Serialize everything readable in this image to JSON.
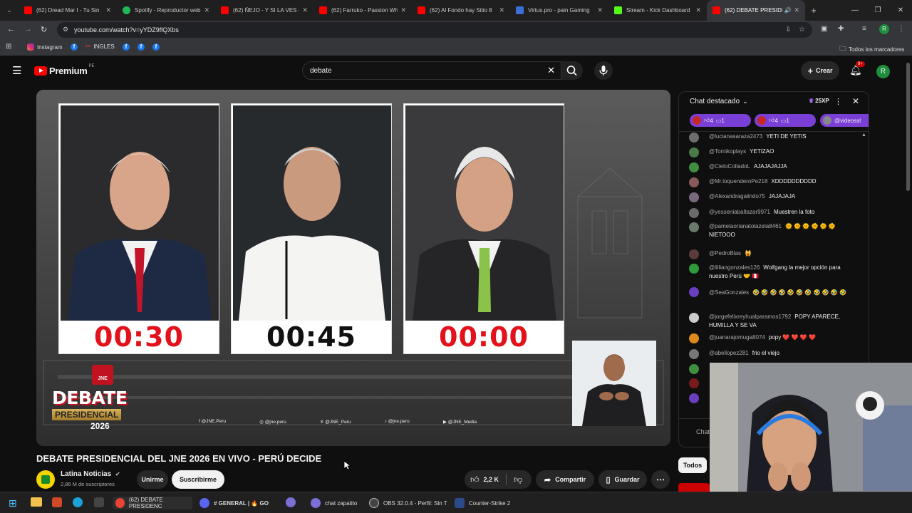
{
  "browser": {
    "tabs": [
      {
        "title": "(62) Dread Mar I - Tu Sin",
        "color": "#ff0000"
      },
      {
        "title": "Spotify - Reproductor web",
        "color": "#1db954"
      },
      {
        "title": "(62) ÑEJO - Y SI LA VES -",
        "color": "#ff0000"
      },
      {
        "title": "(62) Farruko - Passion Wh",
        "color": "#ff0000"
      },
      {
        "title": "(62) Al Fondo hay Sitio 8",
        "color": "#ff0000"
      },
      {
        "title": "Virtus.pro - pain Gaming",
        "color": "#3b6fd8"
      },
      {
        "title": "Stream - Kick Dashboard",
        "color": "#53fc18"
      },
      {
        "title": "(62) DEBATE PRESIDE",
        "color": "#ff0000"
      }
    ],
    "url": "youtube.com/watch?v=yYDZ9flQXbs",
    "bookmarks": {
      "instagram": "Instagram",
      "ingles": "INGLES",
      "all_bookmarks": "Todos los marcadores"
    }
  },
  "youtube": {
    "logo_text": "Premium",
    "region": "PE",
    "search_value": "debate",
    "create_label": "Crear",
    "notif_count": "9+",
    "avatar_letter": "R"
  },
  "video": {
    "timers": [
      "00:30",
      "00:45",
      "00:00"
    ],
    "brand_top": "JNE",
    "brand_title": "DEBATE",
    "brand_sub": "PRESIDENCIAL",
    "brand_year": "2026",
    "socials": [
      "@JNE.Peru",
      "@jne.peru",
      "@JNE_Peru",
      "@jne.peru",
      "@JNE_Media"
    ]
  },
  "meta": {
    "title": "DEBATE PRESIDENCIAL DEL JNE 2026 EN VIVO - PERÚ DECIDE",
    "channel": "Latina Noticias",
    "subscribers": "2,86 M de suscriptores",
    "join": "Unirme",
    "subscribe": "Suscribirme",
    "likes": "2,2 K",
    "share": "Compartir",
    "save": "Guardar"
  },
  "chat": {
    "header": "Chat destacado",
    "xp": "25XP",
    "chips": [
      "4",
      "1",
      "4",
      "1",
      "@videossl"
    ],
    "messages": [
      {
        "author": "@lucianasaraza2473",
        "text": "YETI DE YETIS",
        "color": "#6d6d6d"
      },
      {
        "author": "@Tomikoplays",
        "text": "YETIZAO",
        "color": "#4a7a4a"
      },
      {
        "author": "@CieloColladoL",
        "text": "AJAJAJAJJA",
        "color": "#3f8f3f"
      },
      {
        "author": "@Mr.loquenderoPe218",
        "text": "XDDDDDDDDDD",
        "color": "#8a5a5a"
      },
      {
        "author": "@Alexandragalindo75",
        "text": "JAJAJAJA",
        "color": "#7a6a80"
      },
      {
        "author": "@yesseniabaltazar9971",
        "text": "Muestren la foto",
        "color": "#6a6a6a"
      },
      {
        "author": "@pamelaorianatolazela8461",
        "text": "🌞 🌞 🌞 🌞 🌞 🌞 NIETOOO",
        "color": "#6a7a6a"
      },
      {
        "author": "@PedroBlas",
        "text": "🙀",
        "color": "#5a3a3a"
      },
      {
        "author": "@lilliangonzales126",
        "text": "Wolfgang la mejor opción para nuestro Perú 🤝 🇵🇪",
        "color": "#2e9a3a"
      },
      {
        "author": "@SeaGonzales",
        "text": "🤣 🤣 🤣 🤣 🤣 🤣 🤣 🤣 🤣 🤣 🤣",
        "color": "#6a3fbf"
      },
      {
        "author": "@jorgefelixreyhualparamos1792",
        "text": "POPY APARECE, HUMILLA Y SE VA",
        "color": "#cccccc"
      },
      {
        "author": "@juanarajomuga8074",
        "text": "popy ❤️ ❤️ ❤️ ❤️",
        "color": "#e08a1e"
      },
      {
        "author": "@abellopez281",
        "text": "frio el viejo",
        "color": "#777777"
      }
    ],
    "input_placeholder": "Chat",
    "filter_all": "Todos"
  },
  "taskbar": {
    "items": [
      {
        "label": "(62) DEBATE PRESIDENC",
        "color": "#ea4335"
      },
      {
        "label": "# GENERAL | 🔥 GO",
        "color": "#5865f2"
      },
      {
        "label": "chat zapatito",
        "color": "#7b6fd6"
      },
      {
        "label": "OBS 32.0.4 - Perfil: Sin T",
        "color": "#444444"
      },
      {
        "label": "Counter-Strike 2",
        "color": "#2a4a8a"
      }
    ]
  }
}
